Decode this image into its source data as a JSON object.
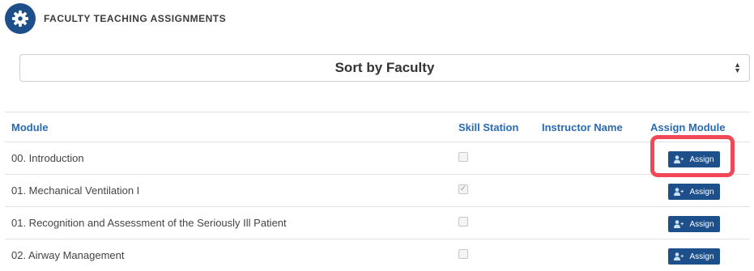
{
  "header": {
    "icon": "gear-icon",
    "title": "FACULTY TEACHING ASSIGNMENTS",
    "brand_color": "#1d4f8a"
  },
  "sort": {
    "selected": "Sort by Faculty",
    "icon": "sort-arrows-icon"
  },
  "table": {
    "headers": {
      "module": "Module",
      "skill_station": "Skill Station",
      "instructor_name": "Instructor Name",
      "assign_module": "Assign Module"
    },
    "header_color": "#2a6bb0",
    "rows": [
      {
        "module": "00. Introduction",
        "skill_station_checked": false,
        "instructor_name": "",
        "assign_label": "Assign"
      },
      {
        "module": "01. Mechanical Ventilation I",
        "skill_station_checked": true,
        "instructor_name": "",
        "assign_label": "Assign"
      },
      {
        "module": "01. Recognition and Assessment of the Seriously Ill Patient",
        "skill_station_checked": false,
        "instructor_name": "",
        "assign_label": "Assign"
      },
      {
        "module": "02. Airway Management",
        "skill_station_checked": false,
        "instructor_name": "",
        "assign_label": "Assign"
      }
    ],
    "assign_button_icon": "add-user-icon"
  },
  "highlight_color": "#f04856"
}
